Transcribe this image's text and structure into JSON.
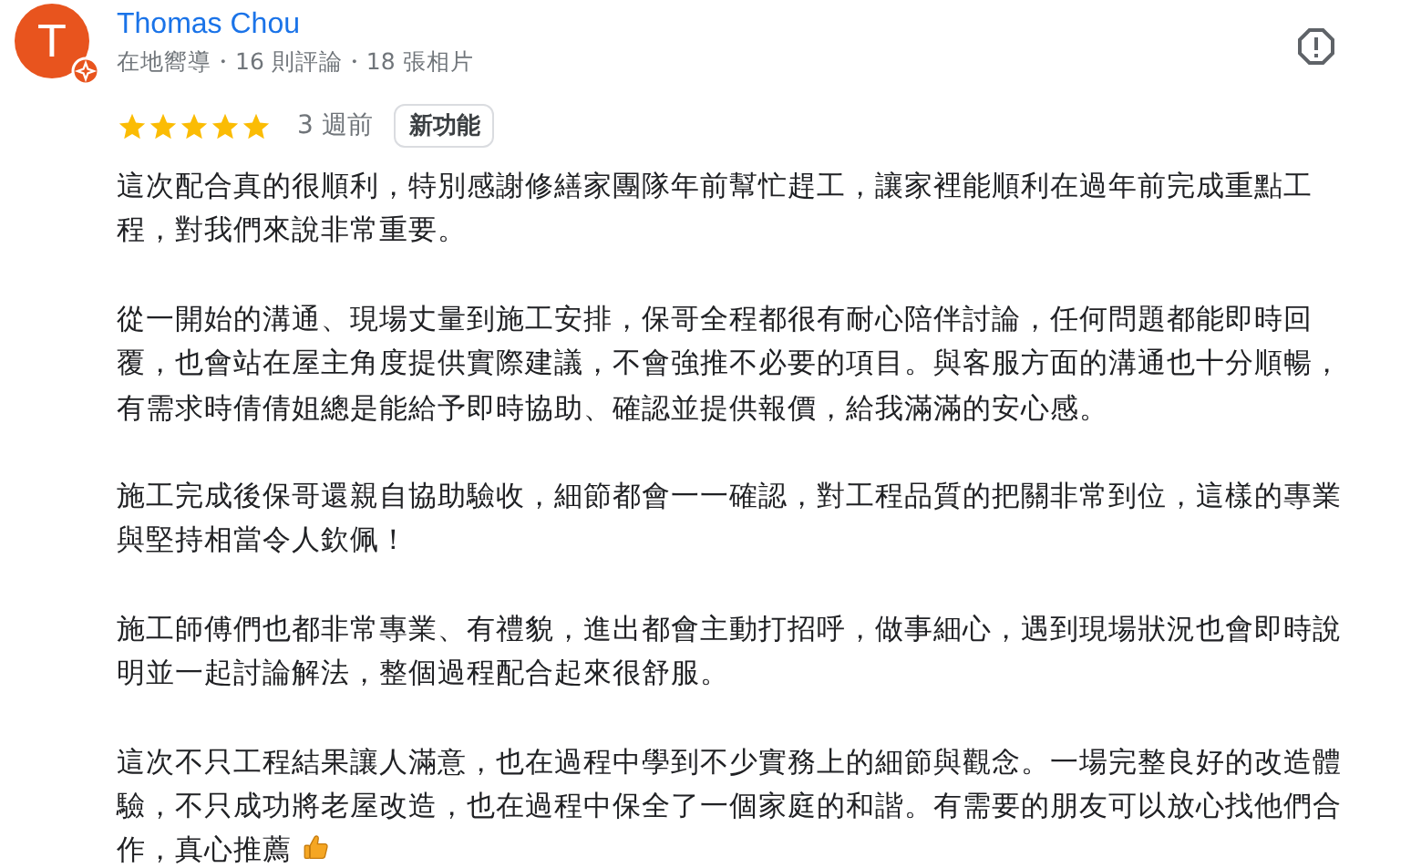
{
  "reviewer": {
    "avatar_letter": "T",
    "name": "Thomas Chou",
    "meta": "在地嚮導・16 則評論・18 張相片",
    "local_guide": true
  },
  "review": {
    "stars": 5,
    "time": "3 週前",
    "badge": "新功能",
    "paragraphs": [
      "這次配合真的很順利，特別感謝修繕家團隊年前幫忙趕工，讓家裡能順利在過年前完成重點工程，對我們來說非常重要。",
      "從一開始的溝通、現場丈量到施工安排，保哥全程都很有耐心陪伴討論，任何問題都能即時回覆，也會站在屋主角度提供實際建議，不會強推不必要的項目。與客服方面的溝通也十分順暢，有需求時倩倩姐總是能給予即時協助、確認並提供報價，給我滿滿的安心感。",
      "施工完成後保哥還親自協助驗收，細節都會一一確認，對工程品質的把關非常到位，這樣的專業與堅持相當令人欽佩！",
      "施工師傅們也都非常專業、有禮貌，進出都會主動打招呼，做事細心，遇到現場狀況也會即時說明並一起討論解法，整個過程配合起來很舒服。",
      "這次不只工程結果讓人滿意，也在過程中學到不少實務上的細節與觀念。一場完整良好的改造體驗，不只成功將老屋改造，也在過程中保全了一個家庭的和諧。有需要的朋友可以放心找他們合作，真心推薦"
    ]
  }
}
